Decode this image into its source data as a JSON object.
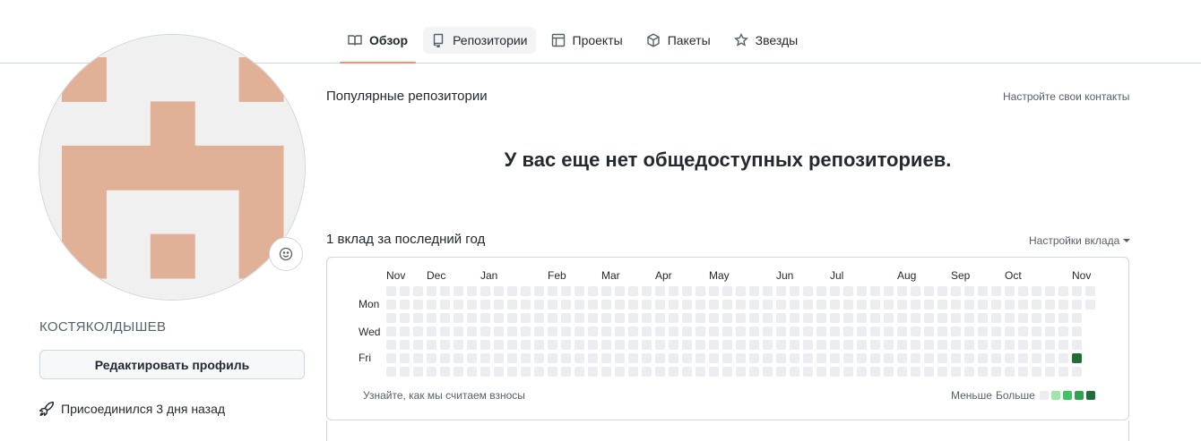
{
  "nav": {
    "tabs": [
      {
        "label": "Обзор",
        "icon": "book-icon",
        "active": true
      },
      {
        "label": "Репозитории",
        "icon": "repo-icon",
        "active": false
      },
      {
        "label": "Проекты",
        "icon": "table-icon",
        "active": false
      },
      {
        "label": "Пакеты",
        "icon": "package-icon",
        "active": false
      },
      {
        "label": "Звезды",
        "icon": "star-icon",
        "active": false
      }
    ],
    "active_underline_color": "#fd8c73"
  },
  "profile": {
    "username": "КОСТЯКОЛДЫШЕВ",
    "edit_button": "Редактировать профиль",
    "joined": "Присоединился 3 дня назад",
    "avatar_color": "#e0b197",
    "avatar_bg": "#f0f0f0"
  },
  "popular": {
    "title": "Популярные репозитории",
    "customize_link": "Настройте свои контакты",
    "empty_message": "У вас еще нет общедоступных репозиториев."
  },
  "contributions": {
    "title": "1 вклад за последний год",
    "settings": "Настройки вклада",
    "months": [
      "Nov",
      "Dec",
      "Jan",
      "Feb",
      "Mar",
      "Apr",
      "May",
      "Jun",
      "Jul",
      "Aug",
      "Sep",
      "Oct",
      "Nov"
    ],
    "day_labels": [
      "Mon",
      "Wed",
      "Fri"
    ],
    "learn_link": "Узнайте, как мы считаем взносы",
    "legend_less": "Меньше",
    "legend_more": "Больше",
    "legend_colors": [
      "#ebedf0",
      "#9be9a8",
      "#40c463",
      "#30a14e",
      "#216e39"
    ],
    "empty_color": "#ebedf0",
    "filled_color": "#216e39",
    "contribution_day": {
      "week": 52,
      "weekday": 5,
      "level": 4
    }
  }
}
